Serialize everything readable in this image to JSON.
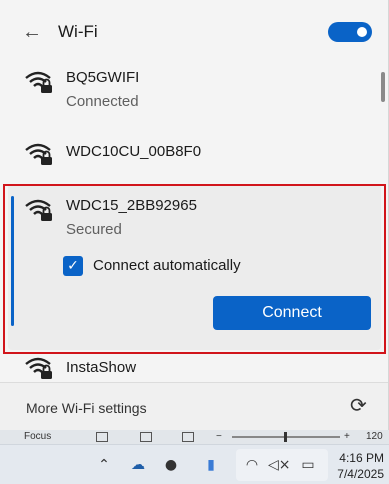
{
  "header": {
    "back_glyph": "←",
    "title": "Wi-Fi",
    "wifi_toggle_on": true
  },
  "networks": [
    {
      "name": "BQ5GWIFI",
      "status": "Connected"
    },
    {
      "name": "WDC10CU_00B8F0",
      "status": ""
    },
    {
      "name": "WDC15_2BB92965",
      "status": "Secured",
      "selected": true,
      "connect_automatically_label": "Connect automatically",
      "connect_automatically_checked": true,
      "connect_button_label": "Connect"
    },
    {
      "name": "InstaShow",
      "status": ""
    }
  ],
  "footer": {
    "more_settings_label": "More Wi-Fi settings",
    "refresh_icon": "refresh-icon"
  },
  "statusbar": {
    "focus_label": "Focus",
    "zoom_minus": "−",
    "zoom_plus": "+",
    "zoom_level": "120"
  },
  "taskbar": {
    "time": "4:16 PM",
    "date": "7/4/2025"
  },
  "colors": {
    "accent": "#0a63c7",
    "highlight_border": "#d1151b"
  }
}
